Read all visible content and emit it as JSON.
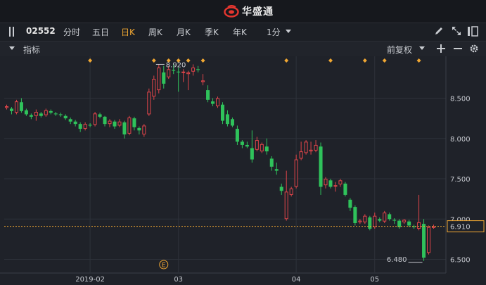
{
  "app": {
    "title": "华盛通",
    "brand_color": "#e5362f"
  },
  "toolbar": {
    "stock_code": "02552",
    "tabs": [
      {
        "label": "分时",
        "active": false
      },
      {
        "label": "五日",
        "active": false
      },
      {
        "label": "日K",
        "active": true
      },
      {
        "label": "周K",
        "active": false
      },
      {
        "label": "月K",
        "active": false
      },
      {
        "label": "季K",
        "active": false
      },
      {
        "label": "年K",
        "active": false
      }
    ],
    "interval": "1分",
    "icons": [
      "pencil-icon",
      "expand-icon",
      "collapse-icon"
    ]
  },
  "indicator_bar": {
    "label": "指标",
    "adjust": "前复权",
    "icons": [
      "plus-icon",
      "minus-icon",
      "gear-icon"
    ]
  },
  "chart_data": {
    "type": "candlestick",
    "y_ticks": [
      "8.500",
      "8.000",
      "7.500",
      "7.000",
      "6.500"
    ],
    "x_ticks": [
      "2019-02",
      "03",
      "04",
      "05"
    ],
    "ylim": [
      6.33,
      9.02
    ],
    "last_price": "6.910",
    "high_label": "8.920",
    "low_label": "6.480",
    "event_marker": "E",
    "grid": true,
    "up_color": "#e0454a",
    "down_color": "#2fc25b",
    "candles": [
      [
        8.38,
        8.42,
        8.36,
        8.4
      ],
      [
        8.37,
        8.39,
        8.3,
        8.34
      ],
      [
        8.32,
        8.48,
        8.3,
        8.46
      ],
      [
        8.45,
        8.5,
        8.32,
        8.34
      ],
      [
        8.35,
        8.37,
        8.28,
        8.3
      ],
      [
        8.29,
        8.31,
        8.24,
        8.27
      ],
      [
        8.28,
        8.36,
        8.22,
        8.33
      ],
      [
        8.31,
        8.33,
        8.26,
        8.28
      ],
      [
        8.29,
        8.37,
        8.27,
        8.35
      ],
      [
        8.34,
        8.36,
        8.3,
        8.32
      ],
      [
        8.31,
        8.33,
        8.28,
        8.3
      ],
      [
        8.3,
        8.32,
        8.27,
        8.29
      ],
      [
        8.28,
        8.3,
        8.23,
        8.25
      ],
      [
        8.24,
        8.26,
        8.18,
        8.21
      ],
      [
        8.21,
        8.23,
        8.15,
        8.18
      ],
      [
        8.18,
        8.2,
        8.08,
        8.12
      ],
      [
        8.12,
        8.2,
        8.1,
        8.18
      ],
      [
        8.17,
        8.19,
        8.14,
        8.16
      ],
      [
        8.17,
        8.33,
        8.15,
        8.31
      ],
      [
        8.3,
        8.32,
        8.25,
        8.27
      ],
      [
        8.27,
        8.28,
        8.15,
        8.18
      ],
      [
        8.18,
        8.24,
        8.14,
        8.22
      ],
      [
        8.21,
        8.23,
        8.12,
        8.15
      ],
      [
        8.16,
        8.24,
        8.14,
        8.21
      ],
      [
        8.2,
        8.22,
        8.0,
        8.05
      ],
      [
        8.06,
        8.28,
        8.04,
        8.26
      ],
      [
        8.25,
        8.27,
        8.1,
        8.14
      ],
      [
        8.13,
        8.15,
        8.05,
        8.1
      ],
      [
        8.05,
        8.18,
        8.02,
        8.16
      ],
      [
        8.3,
        8.62,
        8.28,
        8.58
      ],
      [
        8.52,
        8.78,
        8.48,
        8.74
      ],
      [
        8.6,
        8.92,
        8.56,
        8.88
      ],
      [
        8.82,
        8.9,
        8.62,
        8.68
      ],
      [
        8.76,
        8.9,
        8.74,
        8.86
      ],
      [
        8.85,
        8.92,
        8.8,
        8.84
      ],
      [
        8.83,
        8.88,
        8.58,
        8.82
      ],
      [
        8.82,
        8.86,
        8.7,
        8.83
      ],
      [
        8.8,
        8.84,
        8.6,
        8.82
      ],
      [
        8.83,
        8.92,
        8.78,
        8.88
      ],
      [
        8.86,
        8.9,
        8.82,
        8.85
      ],
      [
        8.7,
        8.8,
        8.66,
        8.72
      ],
      [
        8.6,
        8.66,
        8.45,
        8.48
      ],
      [
        8.46,
        8.5,
        8.4,
        8.43
      ],
      [
        8.4,
        8.52,
        8.38,
        8.5
      ],
      [
        8.42,
        8.45,
        8.18,
        8.22
      ],
      [
        8.3,
        8.35,
        8.15,
        8.18
      ],
      [
        8.24,
        8.26,
        8.14,
        8.16
      ],
      [
        8.12,
        8.16,
        7.92,
        7.96
      ],
      [
        7.96,
        7.98,
        7.88,
        7.92
      ],
      [
        7.92,
        7.96,
        7.88,
        7.9
      ],
      [
        7.88,
        8.1,
        7.7,
        7.74
      ],
      [
        7.86,
        8.02,
        7.84,
        7.98
      ],
      [
        7.84,
        7.95,
        7.82,
        7.93
      ],
      [
        7.9,
        8.0,
        7.8,
        7.84
      ],
      [
        7.75,
        7.78,
        7.6,
        7.65
      ],
      [
        7.62,
        7.7,
        7.55,
        7.6
      ],
      [
        7.4,
        7.44,
        7.3,
        7.35
      ],
      [
        7.0,
        7.6,
        6.98,
        7.34
      ],
      [
        7.3,
        7.4,
        7.28,
        7.38
      ],
      [
        7.4,
        7.8,
        7.38,
        7.74
      ],
      [
        7.75,
        7.96,
        7.73,
        7.84
      ],
      [
        7.82,
        7.98,
        7.8,
        7.96
      ],
      [
        7.84,
        7.96,
        7.8,
        7.86
      ],
      [
        7.85,
        7.98,
        7.83,
        7.92
      ],
      [
        7.9,
        7.95,
        7.3,
        7.4
      ],
      [
        7.42,
        7.52,
        7.38,
        7.5
      ],
      [
        7.48,
        7.5,
        7.38,
        7.4
      ],
      [
        7.41,
        7.46,
        7.34,
        7.42
      ],
      [
        7.43,
        7.5,
        7.4,
        7.48
      ],
      [
        7.44,
        7.46,
        7.28,
        7.3
      ],
      [
        7.24,
        7.26,
        7.1,
        7.14
      ],
      [
        7.15,
        7.17,
        6.92,
        6.95
      ],
      [
        6.96,
        7.0,
        6.94,
        6.98
      ],
      [
        6.96,
        7.06,
        6.94,
        7.04
      ],
      [
        7.02,
        7.04,
        6.86,
        6.88
      ],
      [
        6.9,
        7.08,
        6.88,
        7.04
      ],
      [
        7.0,
        7.02,
        6.96,
        6.98
      ],
      [
        6.97,
        7.1,
        6.95,
        7.08
      ],
      [
        7.06,
        7.08,
        6.98,
        7.0
      ],
      [
        6.99,
        7.01,
        6.94,
        6.98
      ],
      [
        6.98,
        7.0,
        6.88,
        6.9
      ],
      [
        6.96,
        7.0,
        6.94,
        6.99
      ],
      [
        6.97,
        6.99,
        6.9,
        6.92
      ],
      [
        6.91,
        6.93,
        6.88,
        6.9
      ],
      [
        6.88,
        7.3,
        6.86,
        6.96
      ],
      [
        6.94,
        7.0,
        6.48,
        6.52
      ],
      [
        6.58,
        6.92,
        6.56,
        6.9
      ],
      [
        6.89,
        6.93,
        6.88,
        6.91
      ]
    ],
    "diamond_marker_count": 11
  }
}
